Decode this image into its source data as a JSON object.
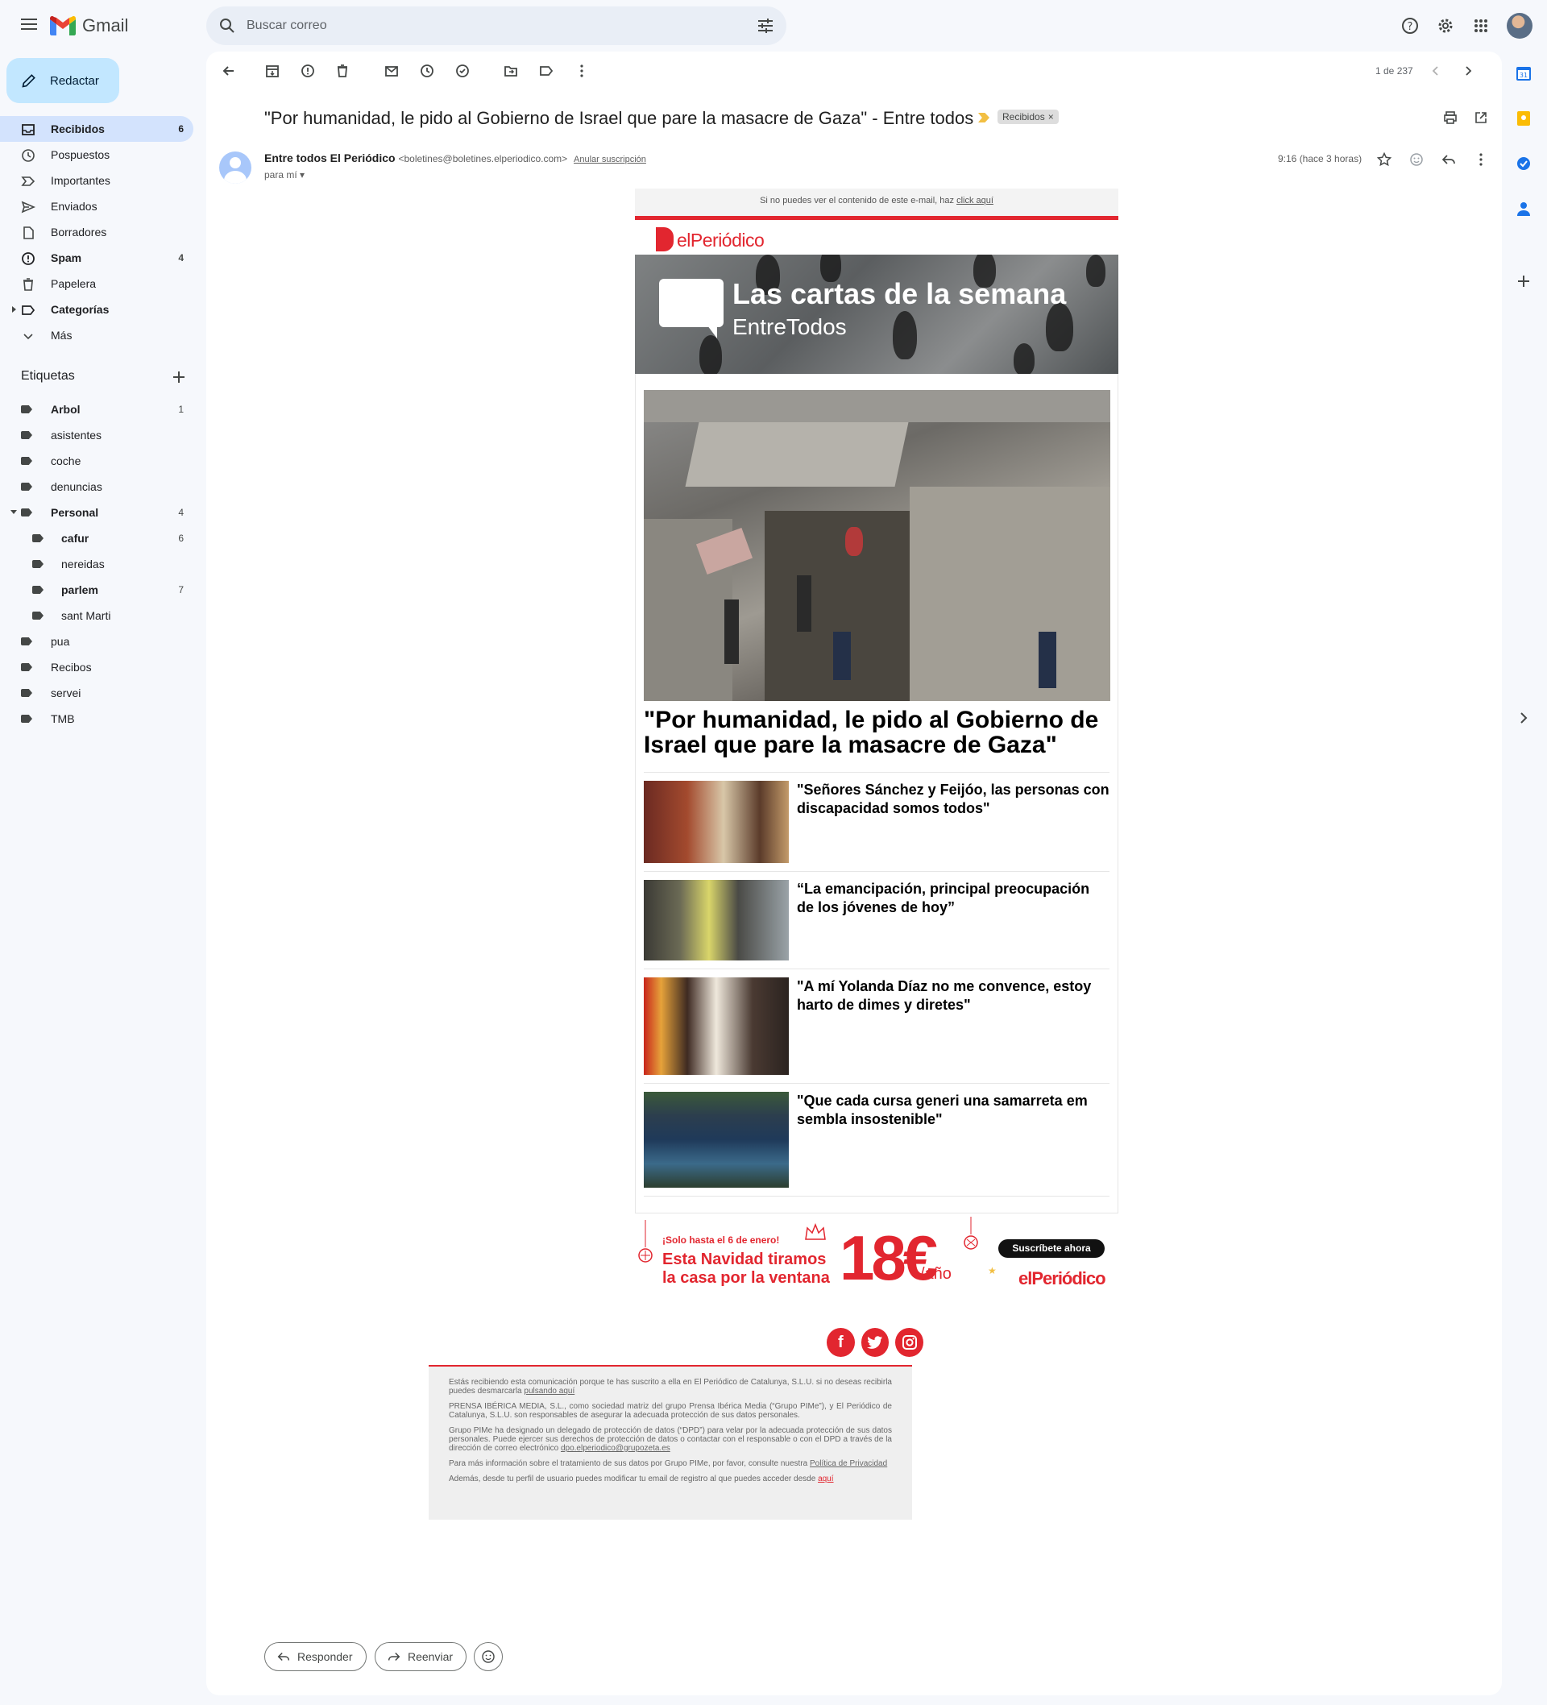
{
  "app": {
    "name": "Gmail"
  },
  "search": {
    "placeholder": "Buscar correo"
  },
  "compose": {
    "label": "Redactar"
  },
  "nav": [
    {
      "label": "Recibidos",
      "count": "6",
      "icon": "inbox-icon",
      "active": true,
      "bold": true
    },
    {
      "label": "Pospuestos",
      "count": "",
      "icon": "clock-icon"
    },
    {
      "label": "Importantes",
      "count": "",
      "icon": "label-important-icon"
    },
    {
      "label": "Enviados",
      "count": "",
      "icon": "send-icon"
    },
    {
      "label": "Borradores",
      "count": "",
      "icon": "draft-icon"
    },
    {
      "label": "Spam",
      "count": "4",
      "icon": "spam-icon",
      "bold": true
    },
    {
      "label": "Papelera",
      "count": "",
      "icon": "trash-icon"
    },
    {
      "label": "Categorías",
      "count": "",
      "icon": "category-icon",
      "bold": true
    },
    {
      "label": "Más",
      "count": "",
      "icon": "expand-more-icon"
    }
  ],
  "labels_section": {
    "title": "Etiquetas"
  },
  "labels": [
    {
      "label": "Arbol",
      "count": "1",
      "bold": true,
      "indent": 0
    },
    {
      "label": "asistentes",
      "count": "",
      "indent": 0
    },
    {
      "label": "coche",
      "count": "",
      "indent": 0
    },
    {
      "label": "denuncias",
      "count": "",
      "indent": 0
    },
    {
      "label": "Personal",
      "count": "4",
      "bold": true,
      "indent": 0
    },
    {
      "label": "cafur",
      "count": "6",
      "bold": true,
      "indent": 1
    },
    {
      "label": "nereidas",
      "count": "",
      "indent": 1
    },
    {
      "label": "parlem",
      "count": "7",
      "bold": true,
      "indent": 1
    },
    {
      "label": "sant Marti",
      "count": "",
      "indent": 1
    },
    {
      "label": "pua",
      "count": "",
      "indent": 0
    },
    {
      "label": "Recibos",
      "count": "",
      "indent": 0
    },
    {
      "label": "servei",
      "count": "",
      "indent": 0
    },
    {
      "label": "TMB",
      "count": "",
      "indent": 0
    }
  ],
  "pager": {
    "text": "1 de 237"
  },
  "email": {
    "subject": "\"Por humanidad, le pido al Gobierno de Israel que pare la masacre de Gaza\" - Entre todos",
    "chip": "Recibidos",
    "chip_close": "×",
    "sender_name": "Entre todos El Periódico",
    "sender_email": "<boletines@boletines.elperiodico.com>",
    "unsubscribe": "Anular suscripción",
    "to": "para mí",
    "time": "9:16 (hace 3 horas)"
  },
  "newsletter": {
    "top_text": "Si no puedes ver el contenido de este e-mail, haz",
    "top_link": "click aquí",
    "brand": "elPeriódico",
    "banner_title": "Las cartas de la semana",
    "banner_subtitle": "EntreTodos",
    "hero_title": "\"Por humanidad, le pido al Gobierno de Israel que pare la masacre de Gaza\"",
    "stories": [
      {
        "title": "\"Señores Sánchez y Feijóo, las personas con discapacidad somos todos\""
      },
      {
        "title": "“La emancipación, principal preocupación de los jóvenes de hoy”"
      },
      {
        "title": "\"A mí Yolanda Díaz no me convence, estoy harto de dimes y diretes\""
      },
      {
        "title": "\"Que cada cursa generi una samarreta em sembla insostenible\""
      }
    ],
    "promo": {
      "limited": "¡Solo hasta el 6 de enero!",
      "headline_1": "Esta Navidad tiramos",
      "headline_2": "la casa por la ventana",
      "price": "18€",
      "period": "/año",
      "cta": "Suscríbete ahora",
      "brand": "elPeriódico"
    },
    "social": [
      "f",
      "t",
      "i"
    ],
    "footer": {
      "p1": "Estás recibiendo esta comunicación porque te has suscrito a ella en El Periódico de Catalunya, S.L.U. si no deseas recibirla puedes desmarcarla",
      "p1_link": "pulsando aquí",
      "p2": "PRENSA IBÉRICA MEDIA, S.L., como sociedad matriz del grupo Prensa Ibérica Media (“Grupo PIMe”), y El Periódico de Catalunya, S.L.U. son responsables de asegurar la adecuada protección de sus datos personales.",
      "p3": "Grupo PIMe ha designado un delegado de protección de datos (“DPD”) para velar por la adecuada protección de sus datos personales. Puede ejercer sus derechos de protección de datos o contactar con el responsable o con el DPD a través de la dirección de correo electrónico",
      "p3_link": "dpo.elperiodico@grupozeta.es",
      "p4": "Para más información sobre el tratamiento de sus datos por Grupo PIMe, por favor, consulte nuestra",
      "p4_link": "Política de Privacidad",
      "p5": "Además, desde tu perfil de usuario puedes modificar tu email de registro al que puedes acceder desde",
      "p5_link": "aquí"
    }
  },
  "actions": {
    "reply": "Responder",
    "forward": "Reenviar"
  },
  "colors": {
    "accent": "#e2262f",
    "active_nav": "#d3e3fd",
    "compose": "#c2e7ff",
    "background": "#f6f8fc"
  }
}
